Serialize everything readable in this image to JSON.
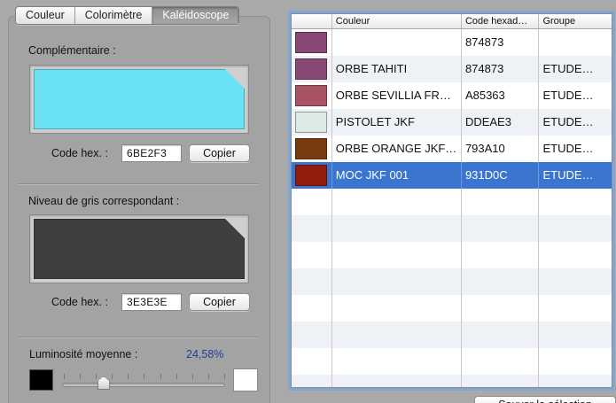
{
  "tabs": [
    {
      "label": "Couleur",
      "active": false
    },
    {
      "label": "Colorimètre",
      "active": false
    },
    {
      "label": "Kaléidoscope",
      "active": true
    }
  ],
  "complementary": {
    "label": "Complémentaire :",
    "color": "#6BE2F3",
    "hex_label": "Code hex. :",
    "hex_value": "6BE2F3",
    "copy_label": "Copier"
  },
  "grayscale": {
    "label": "Niveau de gris correspondant :",
    "color": "#3E3E3E",
    "hex_label": "Code hex. :",
    "hex_value": "3E3E3E",
    "copy_label": "Copier"
  },
  "luminosity": {
    "label": "Luminosité moyenne :",
    "value_text": "24,58%",
    "value": 0.2458
  },
  "table": {
    "columns": [
      "",
      "Couleur",
      "Code hexad…",
      "Groupe"
    ],
    "rows": [
      {
        "color": "#874873",
        "name": "",
        "hex": "874873",
        "group": "",
        "selected": false
      },
      {
        "color": "#874873",
        "name": "ORBE TAHITI",
        "hex": "874873",
        "group": "ETUDE…",
        "selected": false
      },
      {
        "color": "#A85363",
        "name": "ORBE SEVILLIA FR…",
        "hex": "A85363",
        "group": "ETUDE…",
        "selected": false
      },
      {
        "color": "#DDEAE3",
        "name": "PISTOLET JKF",
        "hex": "DDEAE3",
        "group": "ETUDE…",
        "selected": false
      },
      {
        "color": "#793A10",
        "name": "ORBE ORANGE JKF…",
        "hex": "793A10",
        "group": "ETUDE…",
        "selected": false
      },
      {
        "color": "#931D0C",
        "name": "MOC JKF 001",
        "hex": "931D0C",
        "group": "ETUDE…",
        "selected": true
      }
    ],
    "empty_rows": 8
  },
  "bottom_button": {
    "label": "Sauver la sélection"
  }
}
